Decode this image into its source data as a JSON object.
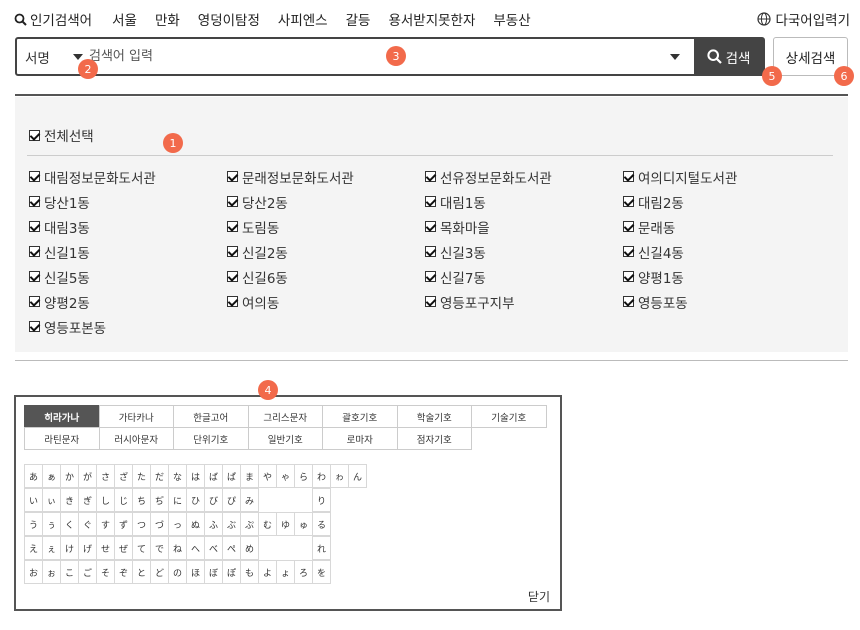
{
  "topnav": {
    "popular_label": "인기검색어",
    "keywords": [
      "서울",
      "만화",
      "영덩이탐정",
      "사피엔스",
      "갈등",
      "용서받지못한자",
      "부동산"
    ],
    "multilang_label": "다국어입력기"
  },
  "search": {
    "field_select": "서명",
    "placeholder": "검색어 입력",
    "button_label": "검색",
    "advanced_label": "상세검색"
  },
  "badges": [
    "1",
    "2",
    "3",
    "4",
    "5",
    "6"
  ],
  "libraries": {
    "select_all": "전체선택",
    "items": [
      "대림정보문화도서관",
      "문래정보문화도서관",
      "선유정보문화도서관",
      "여의디지털도서관",
      "당산1동",
      "당산2동",
      "대림1동",
      "대림2동",
      "대림3동",
      "도림동",
      "목화마을",
      "문래동",
      "신길1동",
      "신길2동",
      "신길3동",
      "신길4동",
      "신길5동",
      "신길6동",
      "신길7동",
      "양평1동",
      "양평2동",
      "여의동",
      "영등포구지부",
      "영등포동",
      "영등포본동"
    ]
  },
  "keyboard": {
    "tabs_row1": [
      "히라가나",
      "가타카나",
      "한글고어",
      "그리스문자",
      "괄호기호",
      "학술기호",
      "기술기호"
    ],
    "tabs_row2": [
      "라틴문자",
      "러시아문자",
      "단위기호",
      "일반기호",
      "로마자",
      "점자기호"
    ],
    "active_tab": "히라가나",
    "rows": [
      [
        "あ",
        "ぁ",
        "か",
        "が",
        "さ",
        "ざ",
        "た",
        "だ",
        "な",
        "は",
        "ば",
        "ぱ",
        "ま",
        "や",
        "ゃ",
        "ら",
        "わ",
        "ゎ",
        "ん"
      ],
      [
        "い",
        "ぃ",
        "き",
        "ぎ",
        "し",
        "じ",
        "ち",
        "ぢ",
        "に",
        "ひ",
        "び",
        "ぴ",
        "み",
        "",
        "",
        "",
        "り",
        "",
        ""
      ],
      [
        "う",
        "ぅ",
        "く",
        "ぐ",
        "す",
        "ず",
        "つ",
        "づ",
        "っ",
        "ぬ",
        "ふ",
        "ぶ",
        "ぷ",
        "む",
        "ゆ",
        "ゅ",
        "る",
        "",
        ""
      ],
      [
        "え",
        "ぇ",
        "け",
        "げ",
        "せ",
        "ぜ",
        "て",
        "で",
        "ね",
        "へ",
        "べ",
        "ぺ",
        "め",
        "",
        "",
        "",
        "れ",
        "",
        ""
      ],
      [
        "お",
        "ぉ",
        "こ",
        "ご",
        "そ",
        "ぞ",
        "と",
        "ど",
        "の",
        "ほ",
        "ぼ",
        "ぽ",
        "も",
        "よ",
        "ょ",
        "ろ",
        "を",
        "",
        ""
      ]
    ],
    "close_label": "닫기"
  },
  "colors": {
    "badge": "#f26a4b",
    "search_button": "#444444",
    "panel_bg": "#f4f4f4"
  }
}
